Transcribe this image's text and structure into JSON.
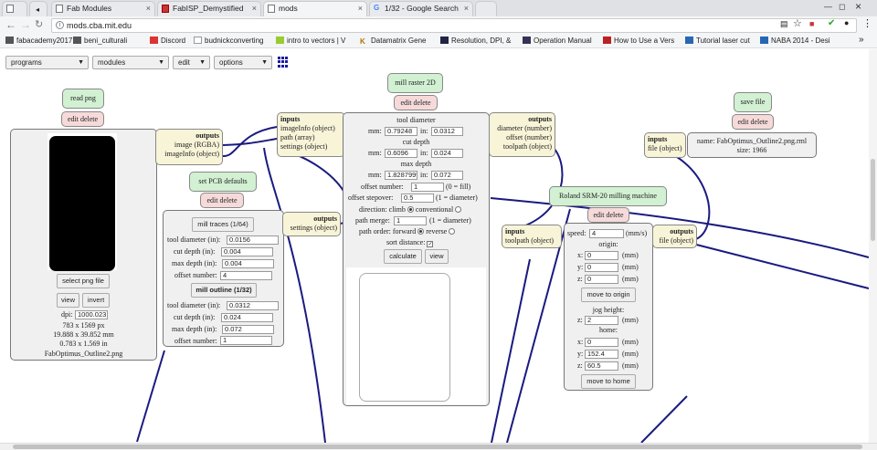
{
  "browser": {
    "tabs": [
      {
        "label": "Fab Modules",
        "close": "×"
      },
      {
        "label": "FabISP_Demystified",
        "close": "×"
      },
      {
        "label": "mods",
        "close": "×"
      },
      {
        "label": "1/32 - Google Search",
        "close": "×"
      }
    ],
    "address": "mods.cba.mit.edu",
    "bookmarks_prefix": "fabacademy2017",
    "bookmarks": [
      "beni_culturali",
      "Discord",
      "budnickconverting",
      "intro to vectors | V",
      "Datamatrix Gene",
      "Resolution, DPI, &",
      "Operation Manual",
      "How to Use a Vers",
      "Tutorial laser cut",
      "NABA 2014 - Desi"
    ],
    "bookmarks_more": "»"
  },
  "menus": [
    "programs",
    "modules",
    "edit",
    "options"
  ],
  "common": {
    "edit_delete": "edit delete"
  },
  "read_png": {
    "title": "read png",
    "select_label": "select png file",
    "view_label": "view",
    "invert_label": "invert",
    "dpi_label": "dpi:",
    "dpi_value": "1000.023",
    "size_px": "783 x 1569 px",
    "size_mm": "19.888 x 39.852 mm",
    "size_in": "0.783 x 1.569 in",
    "filename": "FabOptimus_Outline2.png",
    "outputs_title": "outputs",
    "outputs": [
      "image (RGBA)",
      "imageInfo (object)"
    ]
  },
  "pcb": {
    "title": "set PCB defaults",
    "traces_label": "mill traces (1/64)",
    "outline_label": "mill outline (1/32)",
    "labels": {
      "tool_diameter": "tool diameter (in):",
      "cut_depth": "cut depth (in):",
      "max_depth": "max depth (in):",
      "offset_number": "offset number:"
    },
    "traces": {
      "tool_diameter": "0.0156",
      "cut_depth": "0.004",
      "max_depth": "0.004",
      "offset_number": "4"
    },
    "outline": {
      "tool_diameter": "0.0312",
      "cut_depth": "0.024",
      "max_depth": "0.072",
      "offset_number": "1"
    },
    "outputs_title": "outputs",
    "outputs": [
      "settings (object)"
    ]
  },
  "raster": {
    "title": "mill raster 2D",
    "inputs_title": "inputs",
    "inputs": [
      "imageInfo (object)",
      "path (array)",
      "settings (object)"
    ],
    "outputs_title": "outputs",
    "outputs": [
      "diameter (number)",
      "offset (number)",
      "toolpath (object)"
    ],
    "tool_diameter_h": "tool diameter",
    "cut_depth_h": "cut depth",
    "max_depth_h": "max depth",
    "mm": "mm:",
    "in": "in:",
    "tool_mm": "0.79248",
    "tool_in": "0.0312",
    "cut_mm": "0.6096",
    "cut_in": "0.024",
    "max_mm": "1.8287999",
    "max_in": "0.072",
    "offset_number_label": "offset number:",
    "offset_number": "1",
    "offset_number_hint": "(0 = fill)",
    "offset_stepover_label": "offset stepover:",
    "offset_stepover": "0.5",
    "offset_stepover_hint": "(1 = diameter)",
    "direction_label": "direction:",
    "climb": "climb",
    "conventional": "conventional",
    "path_merge_label": "path merge:",
    "path_merge": "1",
    "path_merge_hint": "(1 = diameter)",
    "path_order_label": "path order:",
    "forward": "forward",
    "reverse": "reverse",
    "sort_distance": "sort distance:",
    "calculate_label": "calculate",
    "view_label": "view"
  },
  "save_file": {
    "title": "save file",
    "inputs_title": "inputs",
    "inputs": [
      "file (object)"
    ],
    "name_line": "name: FabOptimus_Outline2.png.rml",
    "size_line": "size: 1966"
  },
  "roland": {
    "title": "Roland SRM-20 milling machine",
    "inputs_title": "inputs",
    "inputs": [
      "toolpath (object)"
    ],
    "outputs_title": "outputs",
    "outputs": [
      "file (object)"
    ],
    "speed_label": "speed:",
    "speed": "4",
    "speed_unit": "(mm/s)",
    "origin_h": "origin:",
    "x": "x:",
    "y": "y:",
    "z": "z:",
    "unit_mm": "(mm)",
    "origin_x": "0",
    "origin_y": "0",
    "origin_z": "0",
    "move_origin_label": "move to origin",
    "jog_h": "jog height:",
    "jog_z": "2",
    "home_h": "home:",
    "home_x": "0",
    "home_y": "152.4",
    "home_z": "60.5",
    "move_home_label": "move to home"
  }
}
